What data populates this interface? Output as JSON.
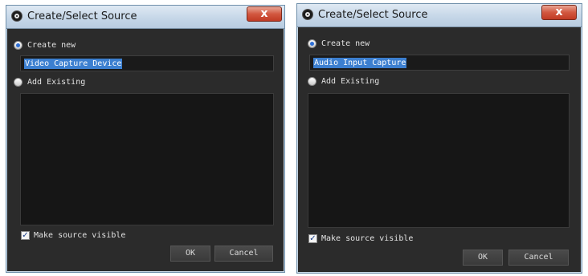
{
  "dialogs": [
    {
      "title": "Create/Select Source",
      "close_symbol": "x",
      "create_new_label": "Create new",
      "source_name": "Video Capture Device",
      "add_existing_label": "Add Existing",
      "make_visible_label": "Make source visible",
      "make_visible_checked": true,
      "ok_label": "OK",
      "cancel_label": "Cancel"
    },
    {
      "title": "Create/Select Source",
      "close_symbol": "x",
      "create_new_label": "Create new",
      "source_name": "Audio Input Capture",
      "add_existing_label": "Add Existing",
      "make_visible_label": "Make source visible",
      "make_visible_checked": true,
      "ok_label": "OK",
      "cancel_label": "Cancel"
    }
  ],
  "icons": {
    "app": "obs-logo-icon",
    "close": "close-icon",
    "checkmark": "checkmark-icon"
  }
}
